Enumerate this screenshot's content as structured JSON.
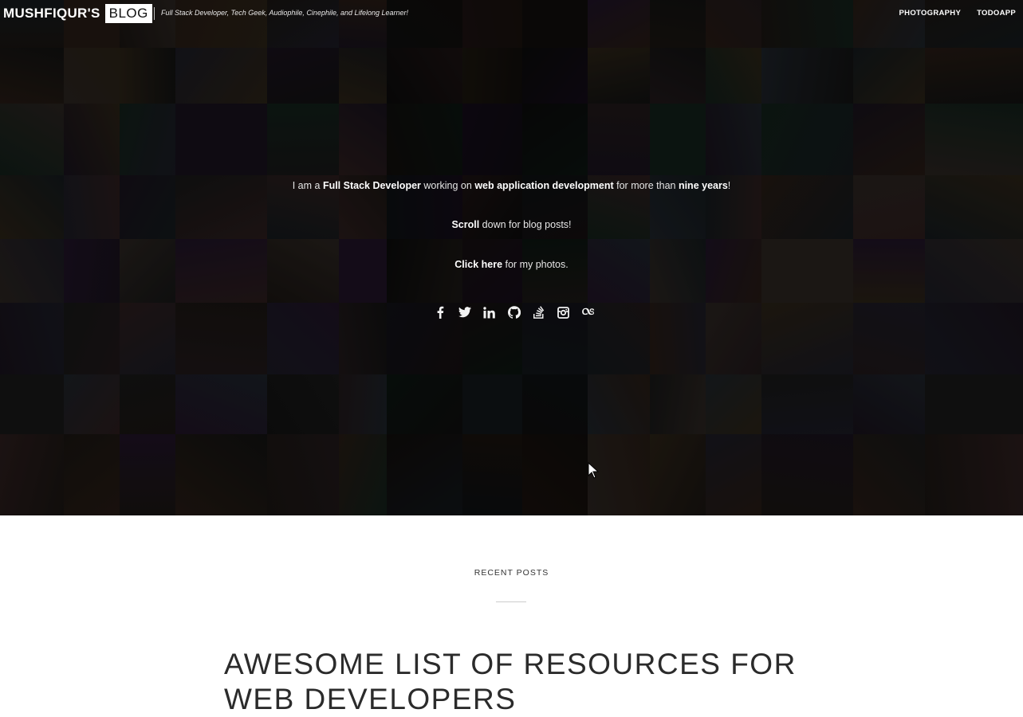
{
  "header": {
    "brand_name": "MUSHFIQUR'S",
    "brand_blog": "BLOG",
    "tagline": "Full Stack Developer, Tech Geek, Audiophile, Cinephile, and Lifelong Learner!",
    "nav": [
      {
        "label": "PHOTOGRAPHY"
      },
      {
        "label": "TODOAPP"
      }
    ]
  },
  "intro": {
    "line1": {
      "t1": "I am a ",
      "b1": "Full Stack Developer",
      "t2": " working on ",
      "b2": "web application development",
      "t3": " for more than ",
      "b3": "nine years",
      "t4": "!"
    },
    "line2": {
      "b1": "Scroll",
      "t1": " down for blog posts!"
    },
    "line3": {
      "link": "Click here",
      "t1": " for my photos."
    }
  },
  "social_icons": [
    "facebook-icon",
    "twitter-icon",
    "linkedin-icon",
    "github-icon",
    "stackoverflow-icon",
    "instagram-icon",
    "lastfm-icon"
  ],
  "main": {
    "section_title": "RECENT POSTS",
    "posts": [
      {
        "title": "AWESOME LIST OF RESOURCES FOR WEB DEVELOPERS"
      }
    ]
  },
  "colors": {
    "hero_bg": "#0b0b0b",
    "text_dark": "#2b2b2b",
    "white": "#ffffff"
  }
}
